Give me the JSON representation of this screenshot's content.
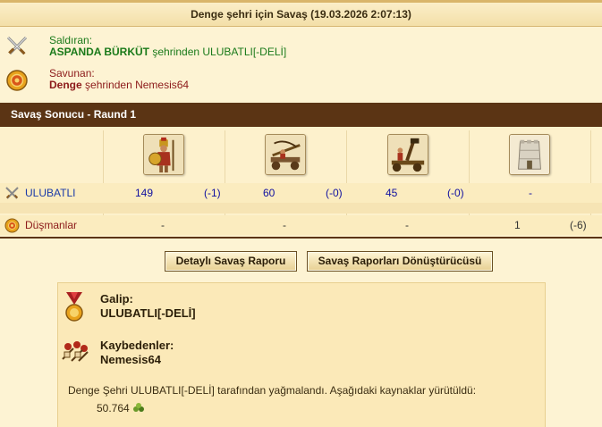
{
  "header": {
    "title": "Denge şehri için Savaş (19.03.2026 2:07:13)"
  },
  "attacker": {
    "role_label": "Saldıran:",
    "player": "ASPANDA BÜRKÜT",
    "city_text": "şehrinden ULUBATLI[-DELİ]",
    "icon": "crossed-swords-icon"
  },
  "defender": {
    "role_label": "Savunan:",
    "city": "Denge",
    "player_text": "şehrinden Nemesis64",
    "icon": "shield-icon"
  },
  "round": {
    "label": "Savaş Sonucu - Raund 1"
  },
  "units": [
    {
      "name": "hoplite-unit-icon"
    },
    {
      "name": "ballista-unit-icon"
    },
    {
      "name": "catapult-unit-icon"
    },
    {
      "name": "wall-unit-icon"
    }
  ],
  "attacker_row": {
    "label": "ULUBATLI",
    "cells": [
      {
        "count": "149",
        "loss": "(-1)"
      },
      {
        "count": "60",
        "loss": "(-0)"
      },
      {
        "count": "45",
        "loss": "(-0)"
      },
      {
        "count": "-",
        "loss": ""
      }
    ]
  },
  "defender_row": {
    "label": "Düşmanlar",
    "cells": [
      {
        "count": "-",
        "loss": ""
      },
      {
        "count": "-",
        "loss": ""
      },
      {
        "count": "-",
        "loss": ""
      },
      {
        "count": "1",
        "loss": "(-6)"
      }
    ]
  },
  "buttons": {
    "detailed_report": "Detaylı Savaş Raporu",
    "report_converter": "Savaş Raporları Dönüştürücüsü"
  },
  "result": {
    "winner_label": "Galip:",
    "winner_name": "ULUBATLI[-DELİ]",
    "loser_label": "Kaybedenler:",
    "loser_name": "Nemesis64",
    "summary": "Denge Şehri ULUBATLI[-DELİ] tarafından yağmalandı. Aşağıdaki kaynaklar yürütüldü:",
    "amount": "50.764"
  }
}
